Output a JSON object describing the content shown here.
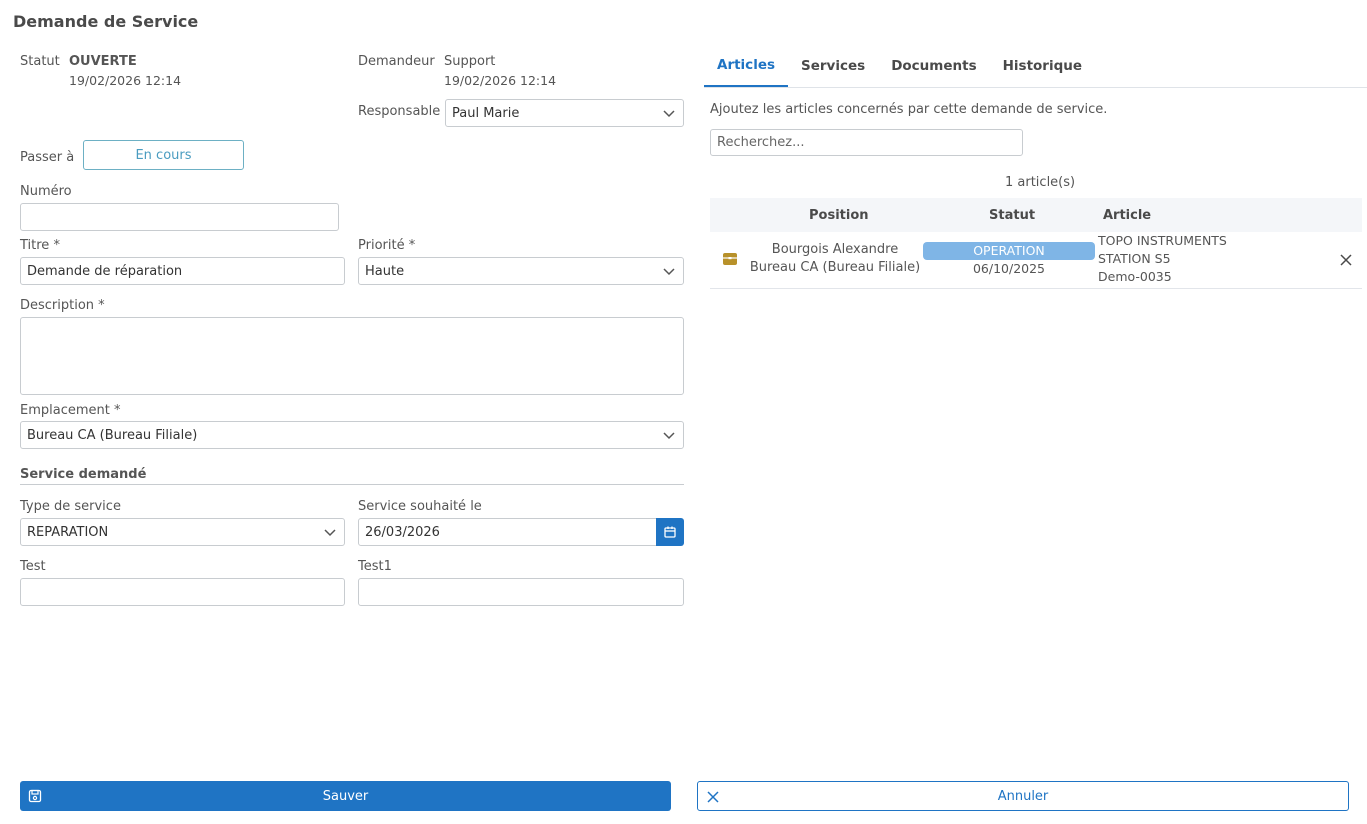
{
  "page_title": "Demande de Service",
  "status": {
    "label": "Statut",
    "value": "OUVERTE",
    "date": "19/02/2026 12:14"
  },
  "requester": {
    "label": "Demandeur",
    "value": "Support",
    "date": "19/02/2026 12:14"
  },
  "responsible": {
    "label": "Responsable",
    "value": "Paul Marie"
  },
  "transition": {
    "label": "Passer à",
    "button": "En cours"
  },
  "fields": {
    "number": {
      "label": "Numéro",
      "value": ""
    },
    "title": {
      "label": "Titre *",
      "value": "Demande de réparation"
    },
    "priority": {
      "label": "Priorité *",
      "value": "Haute"
    },
    "description": {
      "label": "Description *",
      "value": ""
    },
    "location": {
      "label": "Emplacement *",
      "value": "Bureau CA (Bureau Filiale)"
    }
  },
  "service_section": {
    "title": "Service demandé",
    "service_type": {
      "label": "Type de service",
      "value": "REPARATION"
    },
    "desired_date": {
      "label": "Service souhaité le",
      "value": "26/03/2026"
    },
    "test": {
      "label": "Test",
      "value": ""
    },
    "test1": {
      "label": "Test1",
      "value": ""
    }
  },
  "tabs": [
    "Articles",
    "Services",
    "Documents",
    "Historique"
  ],
  "articles": {
    "intro": "Ajoutez les articles concernés par cette demande de service.",
    "search_placeholder": "Recherchez...",
    "count": "1 article(s)",
    "columns": {
      "position": "Position",
      "status": "Statut",
      "article": "Article"
    },
    "rows": [
      {
        "position_line1": "Bourgois Alexandre",
        "position_line2": "Bureau CA (Bureau Filiale)",
        "status_badge": "OPERATION",
        "status_date": "06/10/2025",
        "article_line1": "TOPO INSTRUMENTS",
        "article_line2": "STATION S5",
        "article_line3": "Demo-0035"
      }
    ]
  },
  "footer": {
    "save": "Sauver",
    "cancel": "Annuler"
  },
  "colors": {
    "primary": "#1f74c4",
    "badge": "#7fb5e6",
    "box_icon": "#b8912a"
  },
  "icons": [
    "chevron-down-icon",
    "calendar-icon",
    "box-icon",
    "close-icon",
    "save-icon"
  ]
}
